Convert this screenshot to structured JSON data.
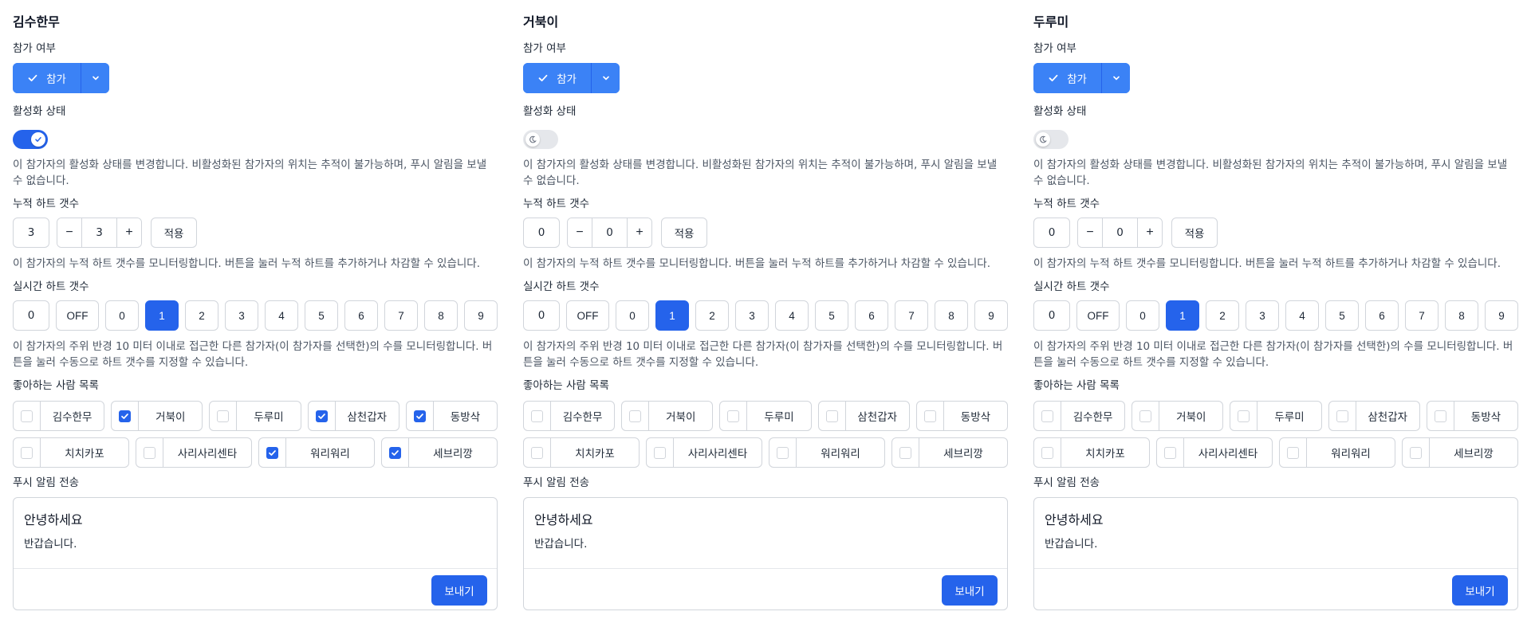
{
  "labels": {
    "participation": "참가 여부",
    "activation": "활성화 상태",
    "activation_help": "이 참가자의 활성화 상태를 변경합니다. 비활성화된 참가자의 위치는 추적이 불가능하며, 푸시 알림을 보낼 수 없습니다.",
    "cumulative": "누적 하트 갯수",
    "cumulative_help": "이 참가자의 누적 하트 갯수를 모니터링합니다. 버튼을 눌러 누적 하트를 추가하거나 차감할 수 있습니다.",
    "apply": "적용",
    "minus": "−",
    "plus": "+",
    "realtime": "실시간 하트 갯수",
    "realtime_help": "이 참가자의 주위 반경 10 미터 이내로 접근한 다른 참가자(이 참가자를 선택한)의 수를 모니터링합니다. 버튼을 눌러 수동으로 하트 갯수를 지정할 수 있습니다.",
    "likes": "좋아하는 사람 목록",
    "push": "푸시 알림 전송",
    "send": "보내기",
    "participate_btn": "참가"
  },
  "realtime_options": [
    "OFF",
    "0",
    "1",
    "2",
    "3",
    "4",
    "5",
    "6",
    "7",
    "8",
    "9"
  ],
  "colors": {
    "primary": "#2563eb",
    "primary_light": "#3b82f6",
    "border": "#d1d5db"
  },
  "participants": [
    {
      "name": "김수한무",
      "participating": true,
      "active": true,
      "cumulative_hearts": "3",
      "stepper_value": "3",
      "realtime_hearts": "0",
      "realtime_selected": "1",
      "likes_row1": [
        {
          "name": "김수한무",
          "checked": false
        },
        {
          "name": "거북이",
          "checked": true
        },
        {
          "name": "두루미",
          "checked": false
        },
        {
          "name": "삼천갑자",
          "checked": true
        },
        {
          "name": "동방삭",
          "checked": true
        }
      ],
      "likes_row2": [
        {
          "name": "치치카포",
          "checked": false
        },
        {
          "name": "사리사리센타",
          "checked": false
        },
        {
          "name": "워리워리",
          "checked": true
        },
        {
          "name": "세브리깡",
          "checked": true
        }
      ],
      "push_title": "안녕하세요",
      "push_body": "반갑습니다."
    },
    {
      "name": "거북이",
      "participating": true,
      "active": false,
      "cumulative_hearts": "0",
      "stepper_value": "0",
      "realtime_hearts": "0",
      "realtime_selected": "1",
      "likes_row1": [
        {
          "name": "김수한무",
          "checked": false
        },
        {
          "name": "거북이",
          "checked": false
        },
        {
          "name": "두루미",
          "checked": false
        },
        {
          "name": "삼천갑자",
          "checked": false
        },
        {
          "name": "동방삭",
          "checked": false
        }
      ],
      "likes_row2": [
        {
          "name": "치치카포",
          "checked": false
        },
        {
          "name": "사리사리센타",
          "checked": false
        },
        {
          "name": "워리워리",
          "checked": false
        },
        {
          "name": "세브리깡",
          "checked": false
        }
      ],
      "push_title": "안녕하세요",
      "push_body": "반갑습니다."
    },
    {
      "name": "두루미",
      "participating": true,
      "active": false,
      "cumulative_hearts": "0",
      "stepper_value": "0",
      "realtime_hearts": "0",
      "realtime_selected": "1",
      "likes_row1": [
        {
          "name": "김수한무",
          "checked": false
        },
        {
          "name": "거북이",
          "checked": false
        },
        {
          "name": "두루미",
          "checked": false
        },
        {
          "name": "삼천갑자",
          "checked": false
        },
        {
          "name": "동방삭",
          "checked": false
        }
      ],
      "likes_row2": [
        {
          "name": "치치카포",
          "checked": false
        },
        {
          "name": "사리사리센타",
          "checked": false
        },
        {
          "name": "워리워리",
          "checked": false
        },
        {
          "name": "세브리깡",
          "checked": false
        }
      ],
      "push_title": "안녕하세요",
      "push_body": "반갑습니다."
    }
  ]
}
